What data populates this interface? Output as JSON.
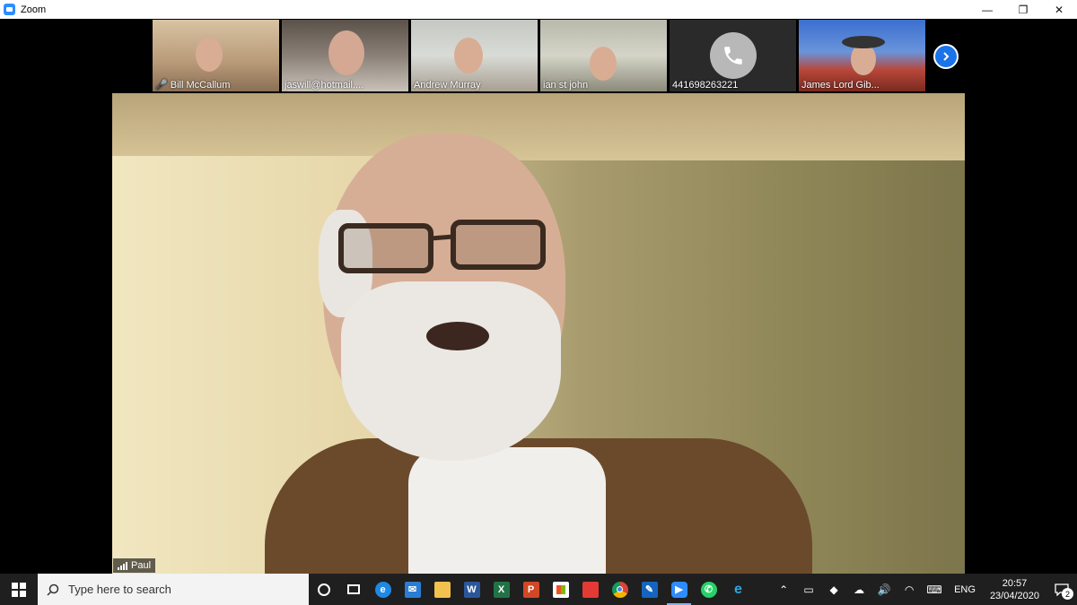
{
  "window": {
    "title": "Zoom",
    "controls": {
      "minimize": "—",
      "restore": "❐",
      "close": "✕"
    }
  },
  "participants": [
    {
      "name": "Bill McCallum",
      "muted": true
    },
    {
      "name": "jaswill@hotmail....",
      "muted": false
    },
    {
      "name": "Andrew Murray",
      "muted": false
    },
    {
      "name": "ian st john",
      "muted": false
    },
    {
      "name": "441698263221",
      "muted": false,
      "phone": true
    },
    {
      "name": "James Lord Gib...",
      "muted": false
    }
  ],
  "speaker": {
    "name": "Paul"
  },
  "taskbar": {
    "search_placeholder": "Type here to search",
    "apps": [
      "cortana-icon",
      "task-view-icon",
      "edge-icon",
      "mail-icon",
      "file-explorer-icon",
      "word-icon",
      "excel-icon",
      "powerpoint-icon",
      "store-icon",
      "red-app-icon",
      "chrome-icon",
      "pen-app-icon",
      "zoom-icon",
      "whatsapp-icon",
      "ie-icon"
    ],
    "active_app": "zoom-icon",
    "language": "ENG",
    "time": "20:57",
    "date": "23/04/2020",
    "notification_count": "2"
  },
  "colors": {
    "zoom_blue": "#2d8cff",
    "taskbar": "#1f1f1f",
    "accent": "#1a73e8"
  }
}
